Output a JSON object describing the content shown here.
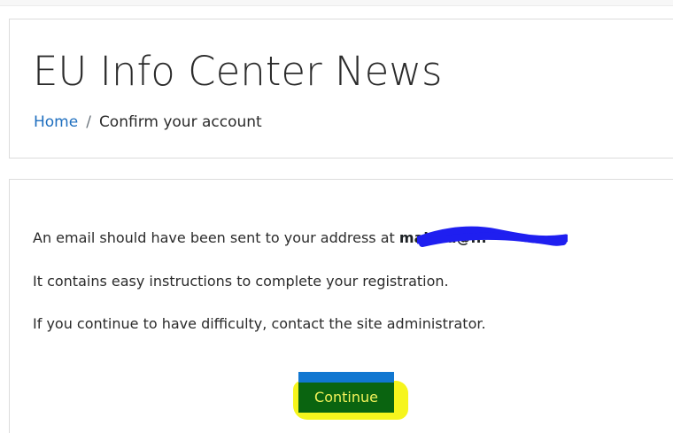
{
  "header": {
    "title": "EU Info Center News",
    "breadcrumb": {
      "home": "Home",
      "separator": "/",
      "current": "Confirm your account"
    }
  },
  "main": {
    "message_1_prefix": "An email should have been sent to your address at",
    "message_1_email": "malzna@...",
    "message_2": "It contains easy instructions to complete your registration.",
    "message_3": "If you continue to have difficulty, contact the site administrator.",
    "continue_label": "Continue"
  },
  "colors": {
    "link": "#1f6fbf",
    "button_bg": "#0a6410",
    "button_text": "#f2f25a",
    "highlight": "#f6f51d",
    "redaction": "#1f1ff0"
  }
}
